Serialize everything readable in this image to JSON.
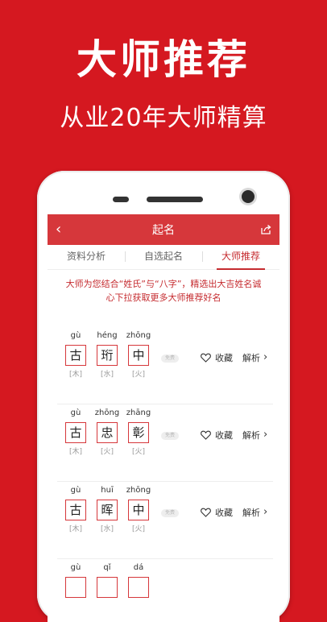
{
  "promo": {
    "headline": "大师推荐",
    "subline": "从业20年大师精算"
  },
  "appbar": {
    "back_icon": "‹",
    "title": "起名",
    "share_icon": "share-icon"
  },
  "tabs": [
    {
      "label": "资料分析"
    },
    {
      "label": "自选起名"
    },
    {
      "label": "大师推荐"
    }
  ],
  "notice": "大师为您结合“姓氏”与“八字”，精选出大吉姓名诚心下拉获取更多大师推荐好名",
  "names": [
    {
      "chars": [
        {
          "pinyin": "gù",
          "hanzi": "古",
          "element": "[木]"
        },
        {
          "pinyin": "héng",
          "hanzi": "珩",
          "element": "[水]"
        },
        {
          "pinyin": "zhōng",
          "hanzi": "中",
          "element": "[火]"
        }
      ],
      "tag": "免费",
      "fav": "收藏",
      "analyze": "解析"
    },
    {
      "chars": [
        {
          "pinyin": "gù",
          "hanzi": "古",
          "element": "[木]"
        },
        {
          "pinyin": "zhōng",
          "hanzi": "忠",
          "element": "[火]"
        },
        {
          "pinyin": "zhāng",
          "hanzi": "彰",
          "element": "[火]"
        }
      ],
      "tag": "免费",
      "fav": "收藏",
      "analyze": "解析"
    },
    {
      "chars": [
        {
          "pinyin": "gù",
          "hanzi": "古",
          "element": "[木]"
        },
        {
          "pinyin": "huī",
          "hanzi": "晖",
          "element": "[水]"
        },
        {
          "pinyin": "zhōng",
          "hanzi": "中",
          "element": "[火]"
        }
      ],
      "tag": "免费",
      "fav": "收藏",
      "analyze": "解析"
    },
    {
      "chars": [
        {
          "pinyin": "gù",
          "hanzi": "",
          "element": ""
        },
        {
          "pinyin": "qǐ",
          "hanzi": "",
          "element": ""
        },
        {
          "pinyin": "dá",
          "hanzi": "",
          "element": ""
        }
      ],
      "tag": "",
      "fav": "",
      "analyze": ""
    }
  ],
  "colors": {
    "brand_red": "#d51820",
    "appbar_red": "#d6373b",
    "accent_red": "#c52b2f"
  }
}
